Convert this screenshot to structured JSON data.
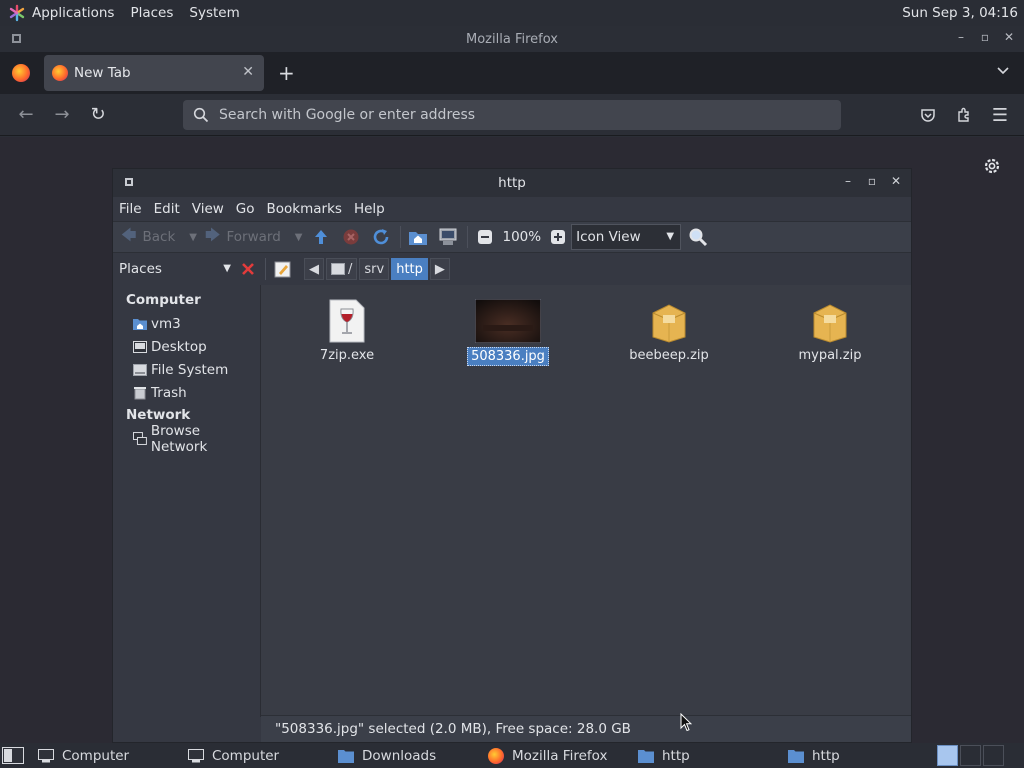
{
  "top_panel": {
    "menus": [
      "Applications",
      "Places",
      "System"
    ],
    "clock": "Sun Sep  3, 04:16"
  },
  "firefox": {
    "window_title": "Mozilla Firefox",
    "tab_label": "New Tab",
    "search_placeholder": "Search with Google or enter address"
  },
  "file_manager": {
    "title": "http",
    "menus": [
      "File",
      "Edit",
      "View",
      "Go",
      "Bookmarks",
      "Help"
    ],
    "toolbar": {
      "back_label": "Back",
      "forward_label": "Forward",
      "zoom": "100%",
      "view_mode": "Icon View"
    },
    "places_label": "Places",
    "breadcrumbs": [
      "/",
      "srv",
      "http"
    ],
    "sidebar": {
      "computer_heading": "Computer",
      "computer_items": [
        "vm3",
        "Desktop",
        "File System",
        "Trash"
      ],
      "network_heading": "Network",
      "network_items": [
        "Browse Network"
      ]
    },
    "files": [
      {
        "name": "7zip.exe",
        "kind": "wine-exe-icon"
      },
      {
        "name": "508336.jpg",
        "kind": "image-thumbnail",
        "selected": true
      },
      {
        "name": "beebeep.zip",
        "kind": "archive-box-icon"
      },
      {
        "name": "mypal.zip",
        "kind": "archive-box-icon"
      }
    ],
    "status": "\"508336.jpg\" selected (2.0 MB), Free space: 28.0 GB"
  },
  "taskbar": {
    "items": [
      "Computer",
      "Computer",
      "Downloads",
      "Mozilla Firefox",
      "http",
      "http"
    ]
  },
  "colors": {
    "selection": "#4a7fc1",
    "panel": "#2a2d35",
    "window_bg": "#353842"
  }
}
